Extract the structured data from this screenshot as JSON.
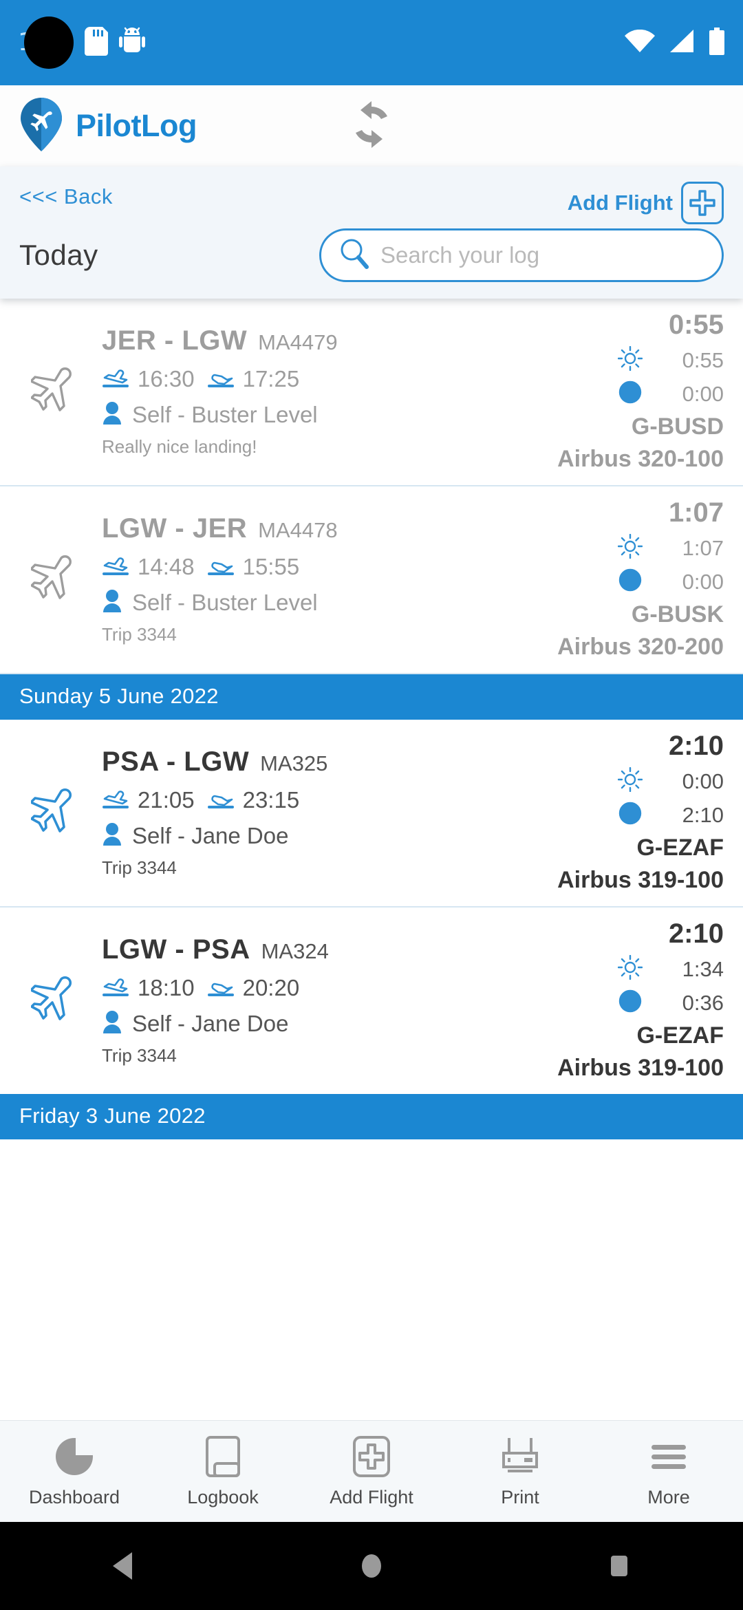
{
  "statusbar": {
    "badge_count": "1",
    "icons": [
      "sd-card-icon",
      "android-icon",
      "wifi-icon",
      "cellular-signal-icon",
      "battery-icon"
    ]
  },
  "appbar": {
    "brand": "PilotLog",
    "logo_icon": "pilotlog-pin-plane-logo",
    "sync_icon": "sync-refresh-icon"
  },
  "subheader": {
    "back_label": "<<< Back",
    "title": "Today",
    "add_flight_label": "Add Flight",
    "add_flight_icon": "plus-icon",
    "search_placeholder": "Search your log",
    "search_value": "",
    "search_icon": "search-magnifier-icon"
  },
  "colors": {
    "brand_blue": "#1b87d2",
    "link_blue": "#2e8fd4",
    "faded_grey": "#9d9d9d",
    "active_dark": "#373737",
    "subheader_bg": "#f2f6fa",
    "tabbar_bg": "#f5f8fa"
  },
  "sections": [
    {
      "date_label": null,
      "flights": [
        {
          "plane_icon": "airplane-icon",
          "state": "faded",
          "route": "JER - LGW",
          "flight_no": "MA4479",
          "takeoff_icon": "takeoff-icon",
          "takeoff_time": "16:30",
          "landing_icon": "landing-icon",
          "landing_time": "17:25",
          "crew_icon": "person-icon",
          "crew": "Self - Buster Level",
          "note": "Really nice landing!",
          "total_time": "0:55",
          "day_icon": "sun-icon",
          "day_time": "0:55",
          "night_icon": "moon-icon",
          "night_time": "0:00",
          "registration": "G-BUSD",
          "aircraft_type": "Airbus 320-100"
        },
        {
          "plane_icon": "airplane-icon",
          "state": "faded",
          "route": "LGW - JER",
          "flight_no": "MA4478",
          "takeoff_icon": "takeoff-icon",
          "takeoff_time": "14:48",
          "landing_icon": "landing-icon",
          "landing_time": "15:55",
          "crew_icon": "person-icon",
          "crew": "Self - Buster Level",
          "note": "Trip 3344",
          "total_time": "1:07",
          "day_icon": "sun-icon",
          "day_time": "1:07",
          "night_icon": "moon-icon",
          "night_time": "0:00",
          "registration": "G-BUSK",
          "aircraft_type": "Airbus 320-200"
        }
      ]
    },
    {
      "date_label": "Sunday 5 June 2022",
      "flights": [
        {
          "plane_icon": "airplane-icon",
          "state": "active",
          "route": "PSA - LGW",
          "flight_no": "MA325",
          "takeoff_icon": "takeoff-icon",
          "takeoff_time": "21:05",
          "landing_icon": "landing-icon",
          "landing_time": "23:15",
          "crew_icon": "person-icon",
          "crew": "Self - Jane Doe",
          "note": "Trip 3344",
          "total_time": "2:10",
          "day_icon": "sun-icon",
          "day_time": "0:00",
          "night_icon": "moon-icon",
          "night_time": "2:10",
          "registration": "G-EZAF",
          "aircraft_type": "Airbus 319-100"
        },
        {
          "plane_icon": "airplane-icon",
          "state": "active",
          "route": "LGW - PSA",
          "flight_no": "MA324",
          "takeoff_icon": "takeoff-icon",
          "takeoff_time": "18:10",
          "landing_icon": "landing-icon",
          "landing_time": "20:20",
          "crew_icon": "person-icon",
          "crew": "Self - Jane Doe",
          "note": "Trip 3344",
          "total_time": "2:10",
          "day_icon": "sun-icon",
          "day_time": "1:34",
          "night_icon": "moon-icon",
          "night_time": "0:36",
          "registration": "G-EZAF",
          "aircraft_type": "Airbus 319-100"
        }
      ]
    },
    {
      "date_label": "Friday 3 June 2022",
      "flights": []
    }
  ],
  "tabbar": {
    "items": [
      {
        "label": "Dashboard",
        "icon": "pie-chart-icon"
      },
      {
        "label": "Logbook",
        "icon": "book-icon"
      },
      {
        "label": "Add Flight",
        "icon": "add-flight-plus-icon"
      },
      {
        "label": "Print",
        "icon": "printer-icon"
      },
      {
        "label": "More",
        "icon": "hamburger-menu-icon"
      }
    ]
  },
  "navbar": {
    "back_icon": "android-back-triangle-icon",
    "home_icon": "android-home-circle-icon",
    "recents_icon": "android-recents-square-icon"
  }
}
